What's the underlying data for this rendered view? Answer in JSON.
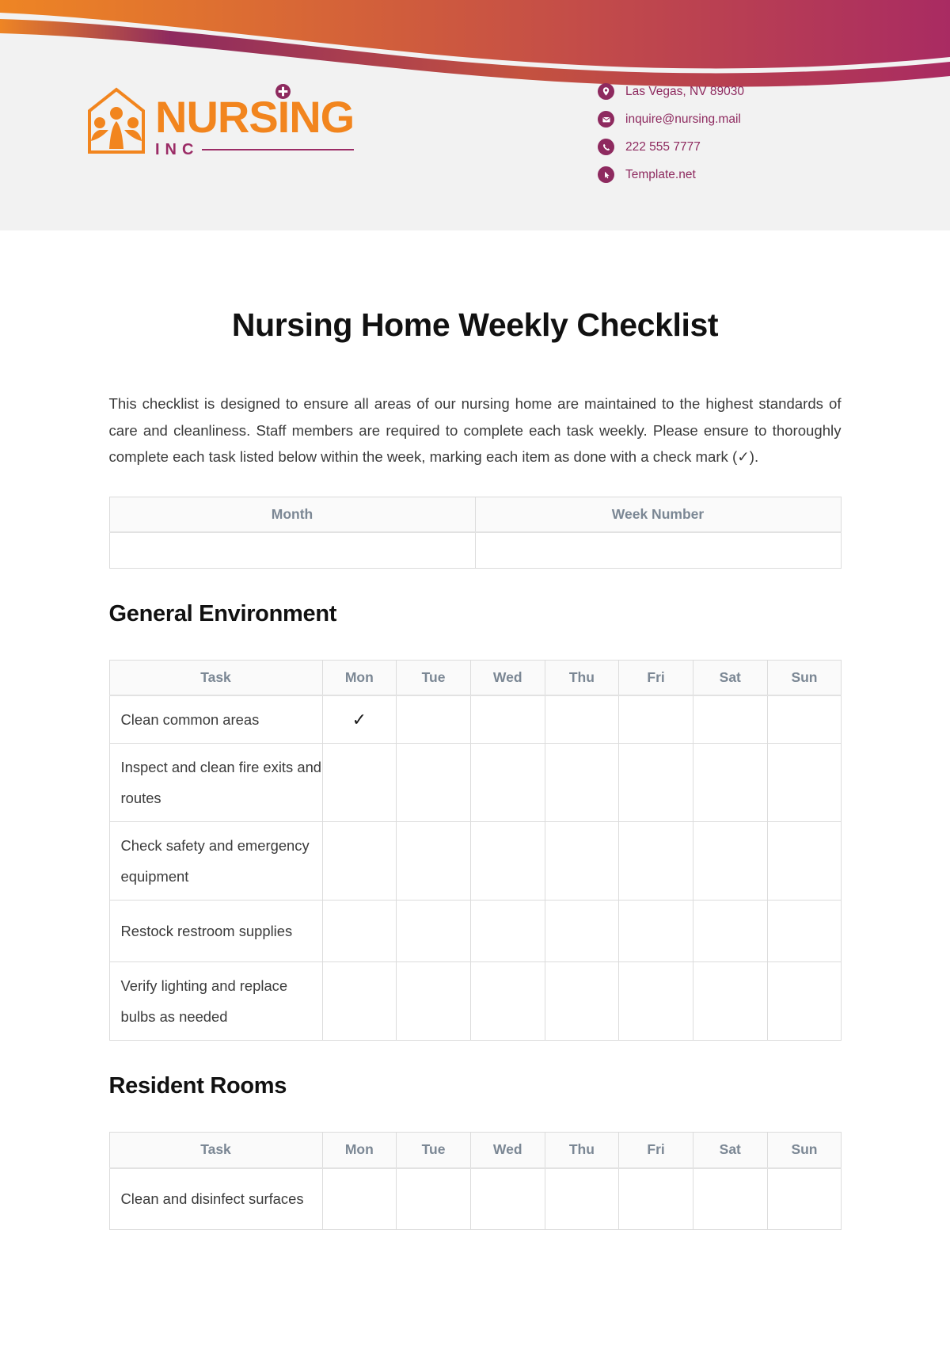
{
  "brand": {
    "logo_word": "NURSING",
    "logo_sub": "INC",
    "logo_icon_name": "nursing-home-logo-icon",
    "orange": "#F2851E",
    "purple": "#8E2A5F"
  },
  "contacts": [
    {
      "icon": "location-pin-icon",
      "text": "Las Vegas, NV 89030"
    },
    {
      "icon": "envelope-icon",
      "text": "inquire@nursing.mail"
    },
    {
      "icon": "phone-icon",
      "text": "222 555 7777"
    },
    {
      "icon": "cursor-arrow-icon",
      "text": "Template.net"
    }
  ],
  "document": {
    "title": "Nursing Home Weekly Checklist",
    "intro": "This checklist is designed to ensure all areas of our nursing home are maintained to the highest standards of care and cleanliness. Staff members are required to complete each task weekly. Please ensure to thoroughly complete each task listed below within the week, marking each item as done with a check mark (✓)."
  },
  "meta_table": {
    "headers": [
      "Month",
      "Week Number"
    ],
    "values": [
      "",
      ""
    ]
  },
  "day_headers": [
    "Task",
    "Mon",
    "Tue",
    "Wed",
    "Thu",
    "Fri",
    "Sat",
    "Sun"
  ],
  "check_mark": "✓",
  "sections": [
    {
      "heading": "General Environment",
      "rows": [
        {
          "task": "Clean common areas",
          "marks": [
            "✓",
            "",
            "",
            "",
            "",
            "",
            ""
          ]
        },
        {
          "task": "Inspect and clean fire exits and routes",
          "marks": [
            "",
            "",
            "",
            "",
            "",
            "",
            ""
          ]
        },
        {
          "task": "Check safety and emergency equipment",
          "marks": [
            "",
            "",
            "",
            "",
            "",
            "",
            ""
          ]
        },
        {
          "task": "Restock restroom supplies",
          "marks": [
            "",
            "",
            "",
            "",
            "",
            "",
            ""
          ]
        },
        {
          "task": "Verify lighting and replace bulbs as needed",
          "marks": [
            "",
            "",
            "",
            "",
            "",
            "",
            ""
          ]
        }
      ]
    },
    {
      "heading": "Resident Rooms",
      "rows": [
        {
          "task": "Clean and disinfect surfaces",
          "marks": [
            "",
            "",
            "",
            "",
            "",
            "",
            ""
          ]
        }
      ]
    }
  ]
}
